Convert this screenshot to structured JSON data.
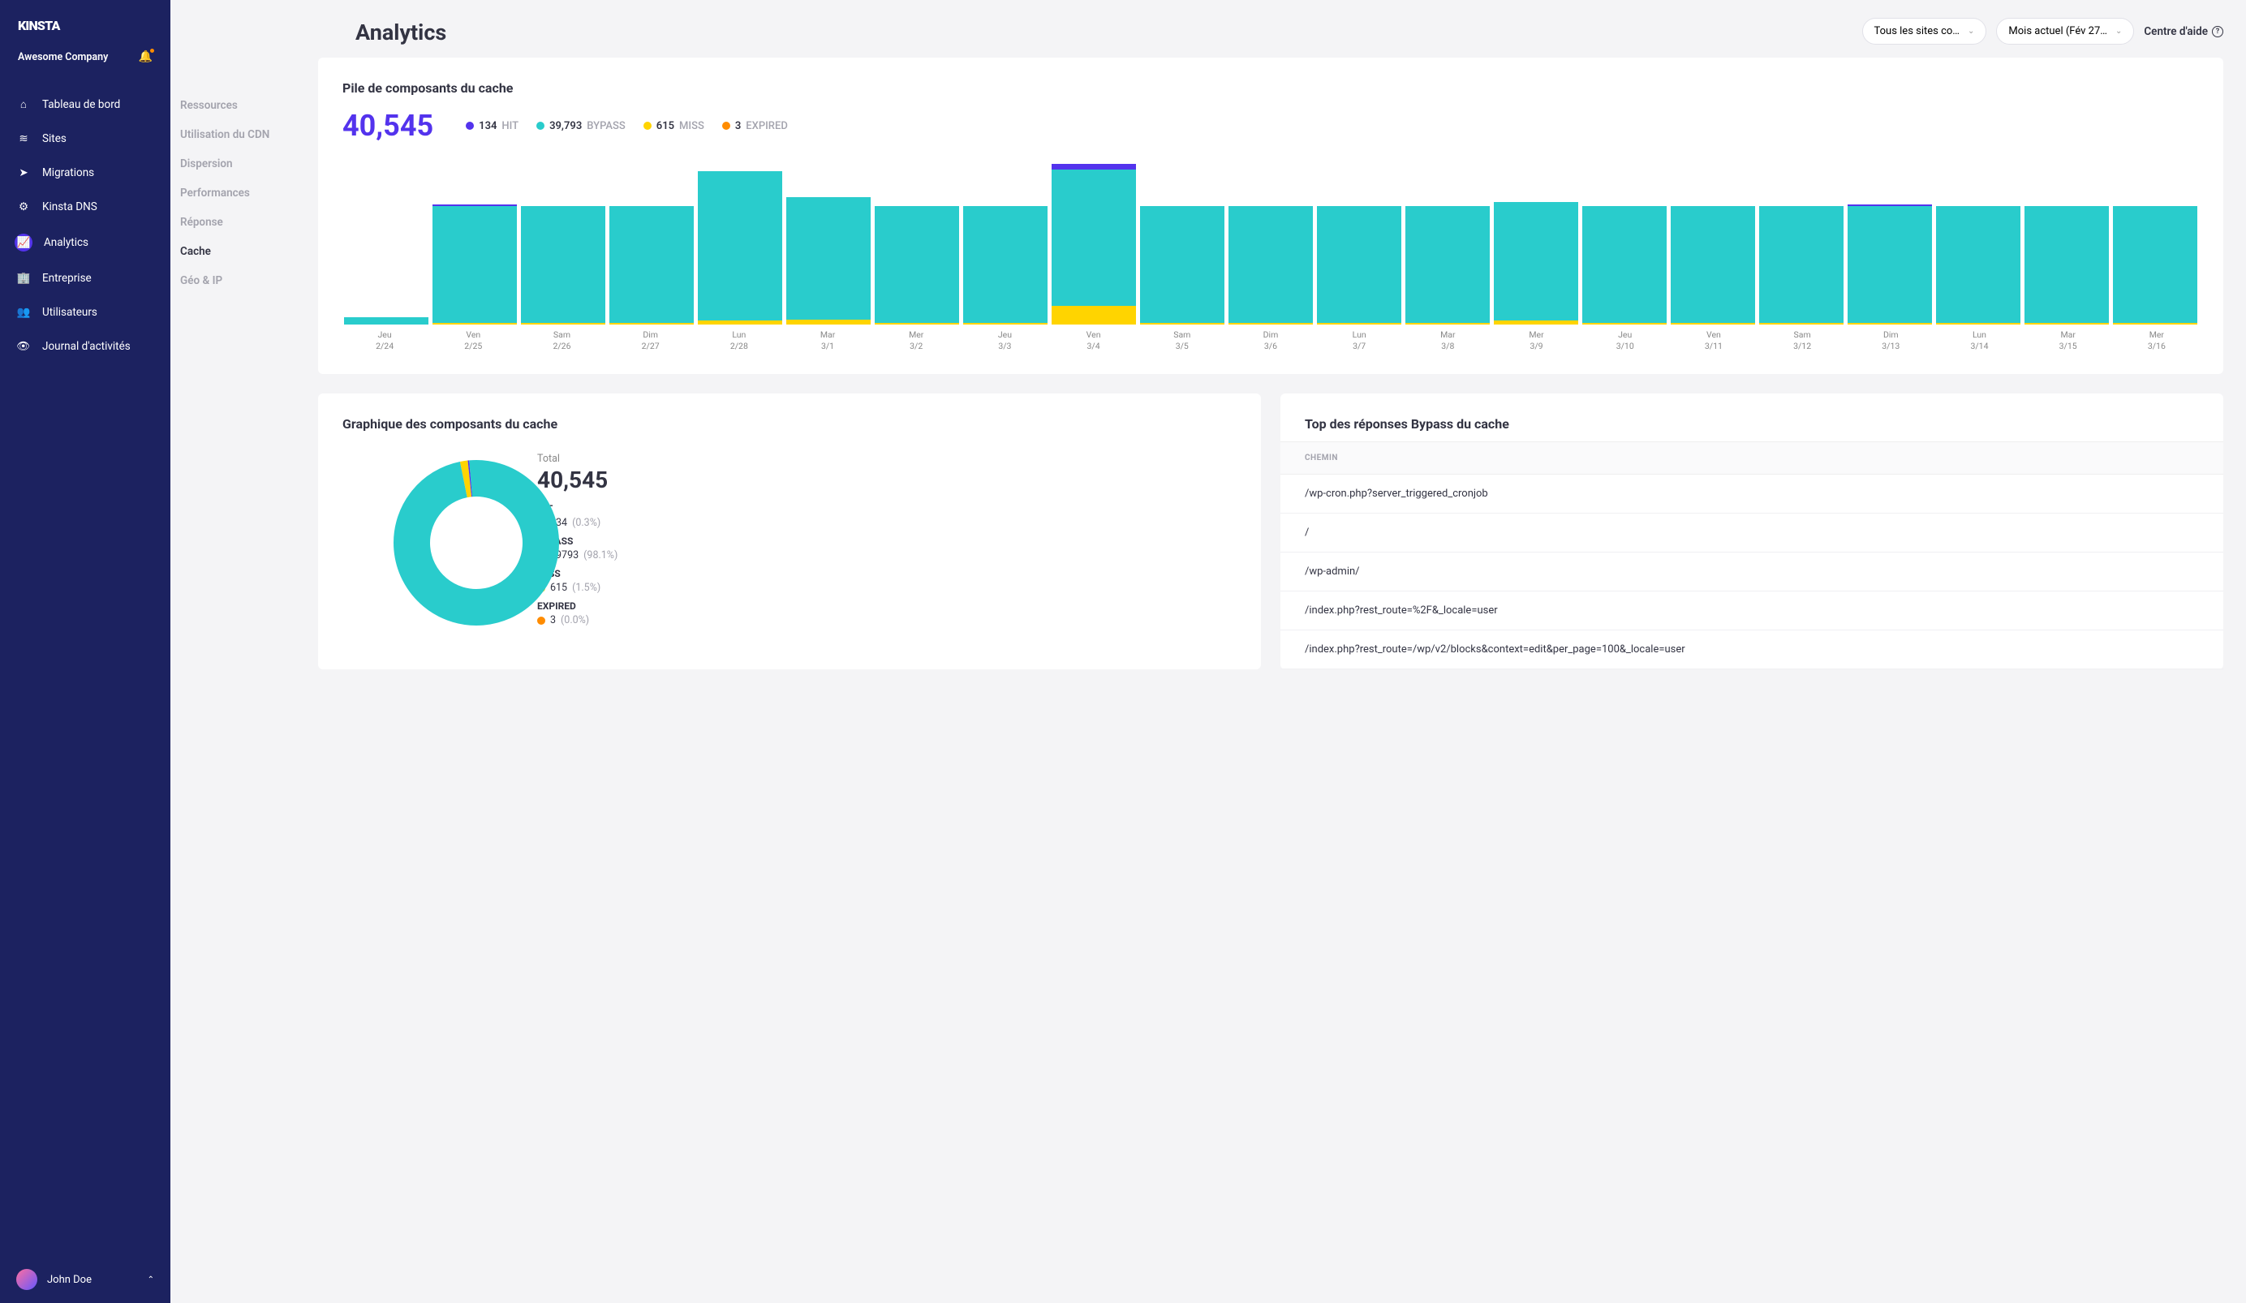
{
  "brand": "KINSTA",
  "company": "Awesome Company",
  "user": "John Doe",
  "page_title": "Analytics",
  "help_label": "Centre d'aide",
  "dd_sites": "Tous les sites co…",
  "dd_month": "Mois actuel (Fév 27…",
  "nav": [
    {
      "label": "Tableau de bord",
      "icon": "home"
    },
    {
      "label": "Sites",
      "icon": "sites"
    },
    {
      "label": "Migrations",
      "icon": "migrations"
    },
    {
      "label": "Kinsta DNS",
      "icon": "dns"
    },
    {
      "label": "Analytics",
      "icon": "analytics",
      "active": true
    },
    {
      "label": "Entreprise",
      "icon": "company"
    },
    {
      "label": "Utilisateurs",
      "icon": "users"
    },
    {
      "label": "Journal d'activités",
      "icon": "activity"
    }
  ],
  "subnav": [
    {
      "label": "Ressources"
    },
    {
      "label": "Utilisation du CDN"
    },
    {
      "label": "Dispersion"
    },
    {
      "label": "Performances"
    },
    {
      "label": "Réponse"
    },
    {
      "label": "Cache",
      "active": true
    },
    {
      "label": "Géo & IP"
    }
  ],
  "stack_card": {
    "title": "Pile de composants du cache",
    "total": "40,545",
    "legend": [
      {
        "name": "HIT",
        "value": "134",
        "color": "#5333ed"
      },
      {
        "name": "BYPASS",
        "value": "39,793",
        "color": "#29cccc"
      },
      {
        "name": "MISS",
        "value": "615",
        "color": "#ffd400"
      },
      {
        "name": "EXPIRED",
        "value": "3",
        "color": "#ff8c00"
      }
    ]
  },
  "chart_data": {
    "type": "bar",
    "title": "Pile de composants du cache",
    "ylabel": "Requests",
    "ylim": [
      0,
      2600
    ],
    "categories": [
      "Jeu 2/24",
      "Ven 2/25",
      "Sam 2/26",
      "Dim 2/27",
      "Lun 2/28",
      "Mar 3/1",
      "Mer 3/2",
      "Jeu 3/3",
      "Ven 3/4",
      "Sam 3/5",
      "Dim 3/6",
      "Lun 3/7",
      "Mar 3/8",
      "Mer 3/9",
      "Jeu 3/10",
      "Ven 3/11",
      "Sam 3/12",
      "Dim 3/13",
      "Lun 3/14",
      "Mar 3/15",
      "Mer 3/16"
    ],
    "series": [
      {
        "name": "HIT",
        "color": "#5333ed",
        "values": [
          0,
          20,
          0,
          0,
          0,
          0,
          0,
          0,
          90,
          0,
          0,
          0,
          0,
          0,
          0,
          0,
          0,
          24,
          0,
          0,
          0
        ]
      },
      {
        "name": "BYPASS",
        "color": "#29cccc",
        "values": [
          120,
          1870,
          1870,
          1870,
          2400,
          1960,
          1870,
          1870,
          2180,
          1870,
          1870,
          1870,
          1870,
          1900,
          1870,
          1870,
          1870,
          1870,
          1870,
          1870,
          1870
        ]
      },
      {
        "name": "MISS",
        "color": "#ffd400",
        "values": [
          0,
          30,
          30,
          30,
          60,
          80,
          30,
          30,
          300,
          30,
          30,
          30,
          30,
          60,
          30,
          30,
          30,
          30,
          30,
          30,
          30
        ]
      },
      {
        "name": "EXPIRED",
        "color": "#ff8c00",
        "values": [
          0,
          0,
          0,
          0,
          0,
          0,
          0,
          0,
          0,
          0,
          0,
          0,
          0,
          0,
          0,
          0,
          0,
          0,
          0,
          0,
          0
        ]
      }
    ]
  },
  "donut_card": {
    "title": "Graphique des composants du cache",
    "total_label": "Total",
    "total": "40,545",
    "rows": [
      {
        "label": "HIT",
        "value": "134",
        "pct": "(0.3%)",
        "color": "#5333ed"
      },
      {
        "label": "BYPASS",
        "value": "39793",
        "pct": "(98.1%)",
        "color": "#29cccc"
      },
      {
        "label": "MISS",
        "value": "615",
        "pct": "(1.5%)",
        "color": "#ffd400"
      },
      {
        "label": "EXPIRED",
        "value": "3",
        "pct": "(0.0%)",
        "color": "#ff8c00"
      }
    ]
  },
  "bypass_card": {
    "title": "Top des réponses Bypass du cache",
    "col": "CHEMIN",
    "rows": [
      "/wp-cron.php?server_triggered_cronjob",
      "/",
      "/wp-admin/",
      "/index.php?rest_route=%2F&_locale=user",
      "/index.php?rest_route=/wp/v2/blocks&context=edit&per_page=100&_locale=user"
    ]
  }
}
